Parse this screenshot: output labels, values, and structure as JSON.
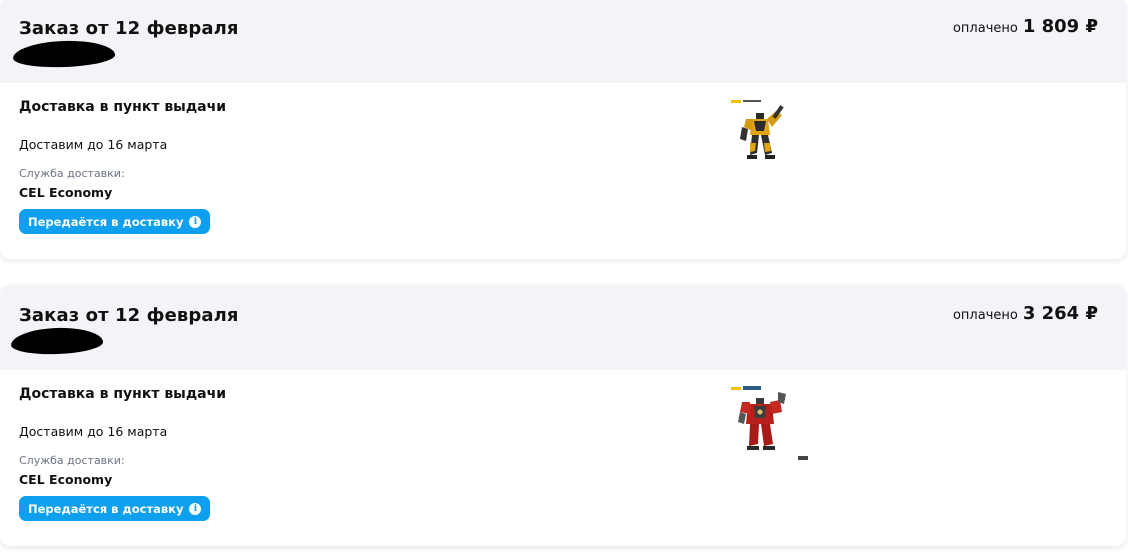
{
  "orders": [
    {
      "title": "Заказ от 12 февраля",
      "paid_label": "оплачено",
      "paid_amount": "1 809 ₽",
      "delivery_type": "Доставка в пункт выдачи",
      "delivery_date": "Доставим до 16 марта",
      "service_label": "Служба доставки:",
      "service_name": "CEL Economy",
      "status": "Передаётся в доставку",
      "status_color": "#0ea0ef",
      "product_image": "yellow-robot-figure"
    },
    {
      "title": "Заказ от 12 февраля",
      "paid_label": "оплачено",
      "paid_amount": "3 264 ₽",
      "delivery_type": "Доставка в пункт выдачи",
      "delivery_date": "Доставим до 16 марта",
      "service_label": "Служба доставки:",
      "service_name": "CEL Economy",
      "status": "Передаётся в доставку",
      "status_color": "#0ea0ef",
      "product_image": "red-armored-figure"
    }
  ],
  "icons": {
    "status_info": "info-icon",
    "redaction": "redaction-scribble"
  }
}
